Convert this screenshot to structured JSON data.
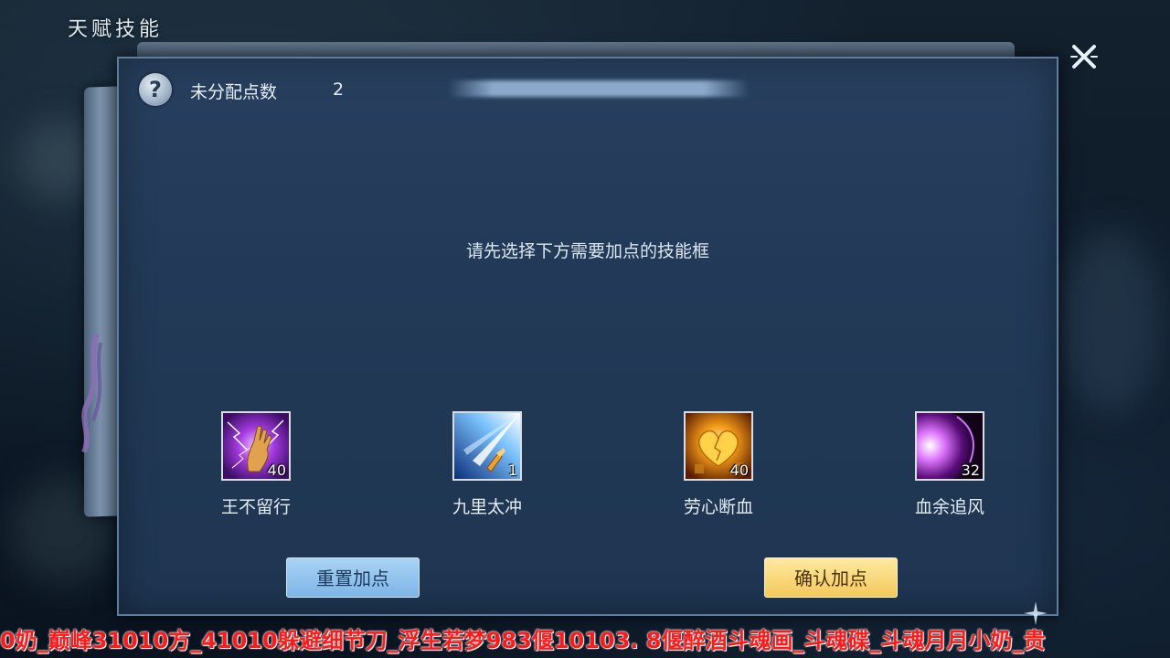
{
  "header": {
    "title": "天赋技能",
    "close_icon": "close-icon"
  },
  "panel": {
    "unassigned_label": "未分配点数",
    "unassigned_value": "2",
    "prompt": "请先选择下方需要加点的技能框",
    "help_icon": "question-icon"
  },
  "skills": [
    {
      "name": "王不留行",
      "level": "40",
      "icon": "lightning-hand-icon",
      "color": "#8a2fd0"
    },
    {
      "name": "九里太冲",
      "level": "1",
      "icon": "sword-beam-icon",
      "color": "#3f8fe0"
    },
    {
      "name": "劳心断血",
      "level": "40",
      "icon": "golden-heart-icon",
      "color": "#e07a10"
    },
    {
      "name": "血余追风",
      "level": "32",
      "icon": "dark-wind-icon",
      "color": "#9b2fc0"
    }
  ],
  "buttons": {
    "reset_label": "重置加点",
    "confirm_label": "确认加点"
  },
  "ticker": {
    "text": "0奶_巅峰31010方_41010躲避细节刀_浮生若梦983偃10103. 8偃醉酒斗魂画_斗魂碟_斗魂月月小奶_贵"
  },
  "colors": {
    "panel_bg": "#223a57",
    "reset_button": "#8fc2ee",
    "confirm_button": "#f6d06a",
    "ticker_text": "#ff1a1a"
  }
}
